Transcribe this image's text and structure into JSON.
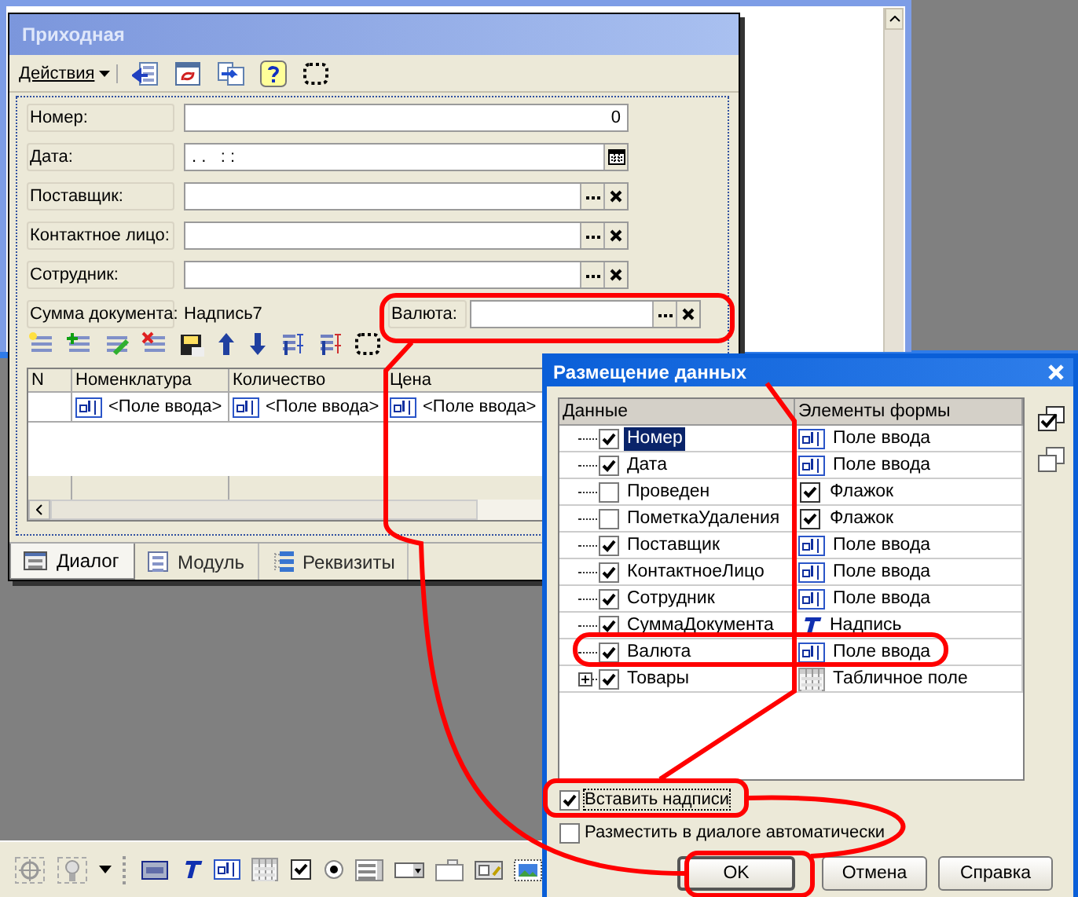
{
  "form": {
    "title": "Приходная",
    "actions_menu": "Действия",
    "fields": [
      {
        "label": "Номер:",
        "value": "0",
        "kind": "number"
      },
      {
        "label": "Дата:",
        "value": ". .   : :",
        "kind": "date"
      },
      {
        "label": "Поставщик:",
        "kind": "reference"
      },
      {
        "label": "Контактное лицо:",
        "kind": "reference"
      },
      {
        "label": "Сотрудник:",
        "kind": "reference"
      }
    ],
    "summary": {
      "label": "Сумма документа:",
      "value": "Надпись7"
    },
    "currency": {
      "label": "Валюта:",
      "kind": "reference"
    },
    "table": {
      "columns": [
        "N",
        "Номенклатура",
        "Количество",
        "Цена"
      ],
      "rows": [
        {
          "cells": [
            "",
            "<Поле ввода>",
            "<Поле ввода>",
            "<Поле ввода>"
          ]
        }
      ]
    },
    "tabs": [
      {
        "label": "Диалог",
        "selected": true
      },
      {
        "label": "Модуль",
        "selected": false
      },
      {
        "label": "Реквизиты",
        "selected": false
      }
    ]
  },
  "dialog": {
    "title": "Размещение данных",
    "columns": [
      "Данные",
      "Элементы формы"
    ],
    "rows": [
      {
        "name": "Номер",
        "checked": true,
        "selected": true,
        "element": "Поле ввода",
        "kind": "input"
      },
      {
        "name": "Дата",
        "checked": true,
        "selected": false,
        "element": "Поле ввода",
        "kind": "input"
      },
      {
        "name": "Проведен",
        "checked": false,
        "selected": false,
        "element": "Флажок",
        "kind": "checkbox"
      },
      {
        "name": "ПометкаУдаления",
        "checked": false,
        "selected": false,
        "element": "Флажок",
        "kind": "checkbox"
      },
      {
        "name": "Поставщик",
        "checked": true,
        "selected": false,
        "element": "Поле ввода",
        "kind": "input"
      },
      {
        "name": "КонтактноеЛицо",
        "checked": true,
        "selected": false,
        "element": "Поле ввода",
        "kind": "input"
      },
      {
        "name": "Сотрудник",
        "checked": true,
        "selected": false,
        "element": "Поле ввода",
        "kind": "input"
      },
      {
        "name": "СуммаДокумента",
        "checked": true,
        "selected": false,
        "element": "Надпись",
        "kind": "label"
      },
      {
        "name": "Валюта",
        "checked": true,
        "selected": false,
        "element": "Поле ввода",
        "kind": "input"
      },
      {
        "name": "Товары",
        "checked": true,
        "selected": false,
        "expanded": false,
        "element": "Табличное поле",
        "kind": "table"
      }
    ],
    "options": [
      {
        "label": "Вставить надписи",
        "checked": true
      },
      {
        "label": "Разместить в диалоге автоматически",
        "checked": false
      }
    ],
    "buttons": [
      {
        "label": "OK",
        "default": true
      },
      {
        "label": "Отмена",
        "default": false
      },
      {
        "label": "Справка",
        "default": false
      }
    ]
  }
}
